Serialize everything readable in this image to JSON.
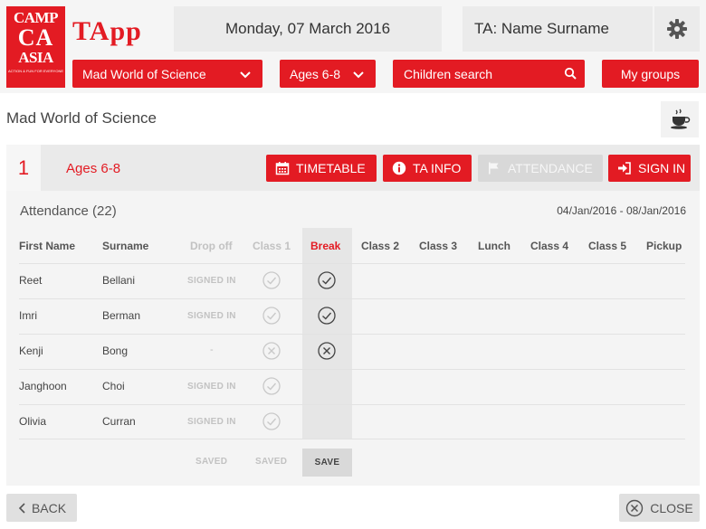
{
  "logo": {
    "line1": "CAMP",
    "line2": "CA",
    "line3": "ASIA",
    "tagline": "ACTION & FUN FOR EVERYONE"
  },
  "app_name": "TApp",
  "header": {
    "date": "Monday, 07 March 2016",
    "ta_name": "TA: Name Surname",
    "course_select": "Mad World of Science",
    "age_select": "Ages 6-8",
    "search_label": "Children search",
    "my_groups_label": "My groups"
  },
  "page_title": "Mad World of Science",
  "group": {
    "number": "1",
    "name": "Ages 6-8",
    "buttons": {
      "timetable": "TIMETABLE",
      "ta_info": "TA INFO",
      "attendance": "ATTENDANCE",
      "sign_in": "SIGN IN"
    }
  },
  "attendance": {
    "title": "Attendance (22)",
    "date_range": "04/Jan/2016 - 08/Jan/2016",
    "columns": [
      "First Name",
      "Surname",
      "Drop off",
      "Class 1",
      "Break",
      "Class 2",
      "Class 3",
      "Lunch",
      "Class 4",
      "Class 5",
      "Pickup"
    ],
    "rows": [
      {
        "first": "Reet",
        "surname": "Bellani",
        "dropoff": "SIGNED IN",
        "class1": "check",
        "break": "check"
      },
      {
        "first": "Imri",
        "surname": "Berman",
        "dropoff": "SIGNED IN",
        "class1": "check",
        "break": "check"
      },
      {
        "first": "Kenji",
        "surname": "Bong",
        "dropoff": "-",
        "class1": "cross",
        "break": "cross"
      },
      {
        "first": "Janghoon",
        "surname": "Choi",
        "dropoff": "SIGNED IN",
        "class1": "check",
        "break": ""
      },
      {
        "first": "Olivia",
        "surname": "Curran",
        "dropoff": "SIGNED IN",
        "class1": "check",
        "break": ""
      }
    ],
    "footer": {
      "dropoff": "SAVED",
      "class1": "SAVED",
      "break": "SAVE"
    }
  },
  "bottom": {
    "back_label": "BACK",
    "close_label": "CLOSE"
  },
  "colors": {
    "accent": "#e31b23",
    "muted": "#c2c2c2",
    "panel": "#f4f4f4"
  },
  "icons": [
    "gear-icon",
    "chevron-down-icon",
    "search-icon",
    "coffee-cup-icon",
    "calendar-icon",
    "info-icon",
    "flag-icon",
    "sign-in-icon",
    "check-circle-icon",
    "cross-circle-icon",
    "chevron-left-icon",
    "close-circle-icon"
  ]
}
